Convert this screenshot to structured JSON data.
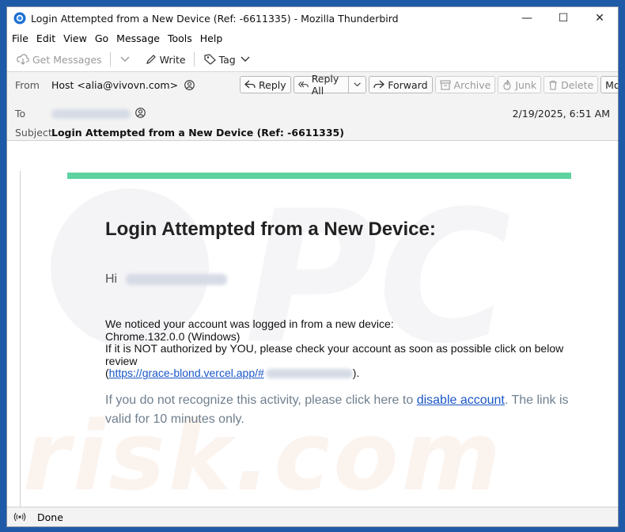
{
  "window": {
    "title": "Login Attempted from a New Device (Ref: -6611335) - Mozilla Thunderbird",
    "minimize": "—",
    "maximize": "☐",
    "close": "✕"
  },
  "menu": [
    "File",
    "Edit",
    "View",
    "Go",
    "Message",
    "Tools",
    "Help"
  ],
  "toolbar": {
    "get_messages": "Get Messages",
    "write": "Write",
    "tag": "Tag"
  },
  "header": {
    "from_label": "From",
    "from_value": "Host <alia@vivovn.com>",
    "to_label": "To",
    "subject_label": "Subject",
    "subject_value": "Login Attempted from a New Device (Ref: -6611335)",
    "date": "2/19/2025, 6:51 AM",
    "buttons": {
      "reply": "Reply",
      "reply_all": "Reply All",
      "forward": "Forward",
      "archive": "Archive",
      "junk": "Junk",
      "delete": "Delete",
      "more": "More"
    }
  },
  "email": {
    "heading": "Login Attempted from a New Device:",
    "greeting": "Hi",
    "line1": "We noticed your account was logged in from a new device:",
    "line2": "Chrome.132.0.0 (Windows)",
    "line3": "If it is NOT authorized by YOU, please check your account as soon as possible click on below review",
    "link_open": "(",
    "link": "https://grace-blond.vercel.app/#",
    "link_close": ").",
    "para_prefix": "If you do not recognize this activity, please click here to ",
    "para_link": "disable account",
    "para_suffix": ". The link is valid for 10 minutes only."
  },
  "status": {
    "text": "Done"
  },
  "colors": {
    "accent_bar": "#5ed3a0",
    "link": "#1a56c6"
  }
}
